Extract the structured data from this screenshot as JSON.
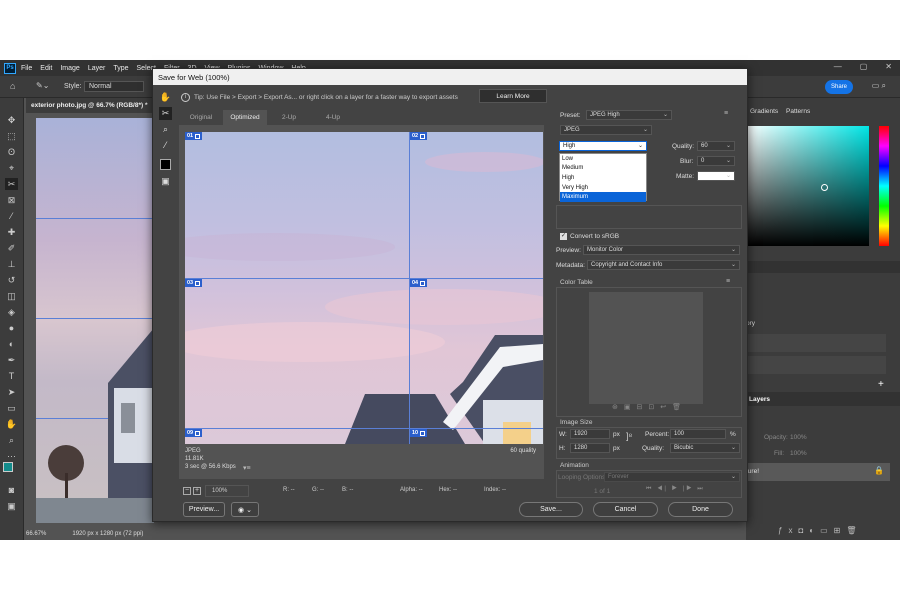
{
  "app": {
    "logo": "Ps",
    "menu": [
      "File",
      "Edit",
      "Image",
      "Layer",
      "Type",
      "Select",
      "Filter",
      "3D",
      "View",
      "Plugins",
      "Window",
      "Help"
    ],
    "window_controls": [
      "—",
      "▢",
      "✕"
    ],
    "style_label": "Style:",
    "style_value": "Normal",
    "share_label": "Share",
    "doc_tab": "exterior photo.jpg @ 66.7% (RGB/8*) *",
    "zoom_status": "66.67%",
    "dimensions_status": "1920 px x 1280 px (72 ppi)",
    "panels": {
      "gradients": "Gradients",
      "patterns": "Patterns",
      "layers": "Layers",
      "history_item": "ory",
      "opacity_label": "Opacity:",
      "opacity_value": "100%",
      "fill_label": "Fill:",
      "fill_value": "100%",
      "layer_name": "ture!"
    }
  },
  "dialog": {
    "title": "Save for Web (100%)",
    "tip": "Tip: Use File > Export > Export As...  or right click on a layer for a faster way to export assets",
    "learn_more": "Learn More",
    "tabs": [
      "Original",
      "Optimized",
      "2-Up",
      "4-Up"
    ],
    "active_tab": "Optimized",
    "slices": [
      "01",
      "02",
      "03",
      "04",
      "09",
      "10"
    ],
    "image_info": {
      "format": "JPEG",
      "size": "11.81K",
      "time": "3 sec @ 56.6 Kbps"
    },
    "quality_readout": "60 quality",
    "bottom": {
      "zoom": "100%",
      "r": "R: --",
      "g": "G: --",
      "b": "B: --",
      "alpha": "Alpha: --",
      "hex": "Hex: --",
      "index": "Index: --"
    },
    "buttons": {
      "preview": "Preview...",
      "save": "Save...",
      "cancel": "Cancel",
      "done": "Done"
    },
    "settings": {
      "preset_label": "Preset:",
      "preset_value": "JPEG High",
      "format_value": "JPEG",
      "quality_level": "High",
      "quality_options": [
        "Low",
        "Medium",
        "High",
        "Very High",
        "Maximum"
      ],
      "highlighted_option": "Maximum",
      "quality_label": "Quality:",
      "quality_value": "60",
      "blur_label": "Blur:",
      "blur_value": "0",
      "matte_label": "Matte:",
      "convert_srgb": "Convert to sRGB",
      "preview_label": "Preview:",
      "preview_value": "Monitor Color",
      "metadata_label": "Metadata:",
      "metadata_value": "Copyright and Contact Info",
      "color_table": "Color Table",
      "image_size": "Image Size",
      "w_label": "W:",
      "w_value": "1920",
      "h_label": "H:",
      "h_value": "1280",
      "px": "px",
      "percent_label": "Percent:",
      "percent_value": "100",
      "percent_unit": "%",
      "quality2_label": "Quality:",
      "quality2_value": "Bicubic",
      "animation": "Animation",
      "looping_label": "Looping Options:",
      "looping_value": "Forever",
      "frame_counter": "1 of 1"
    }
  }
}
